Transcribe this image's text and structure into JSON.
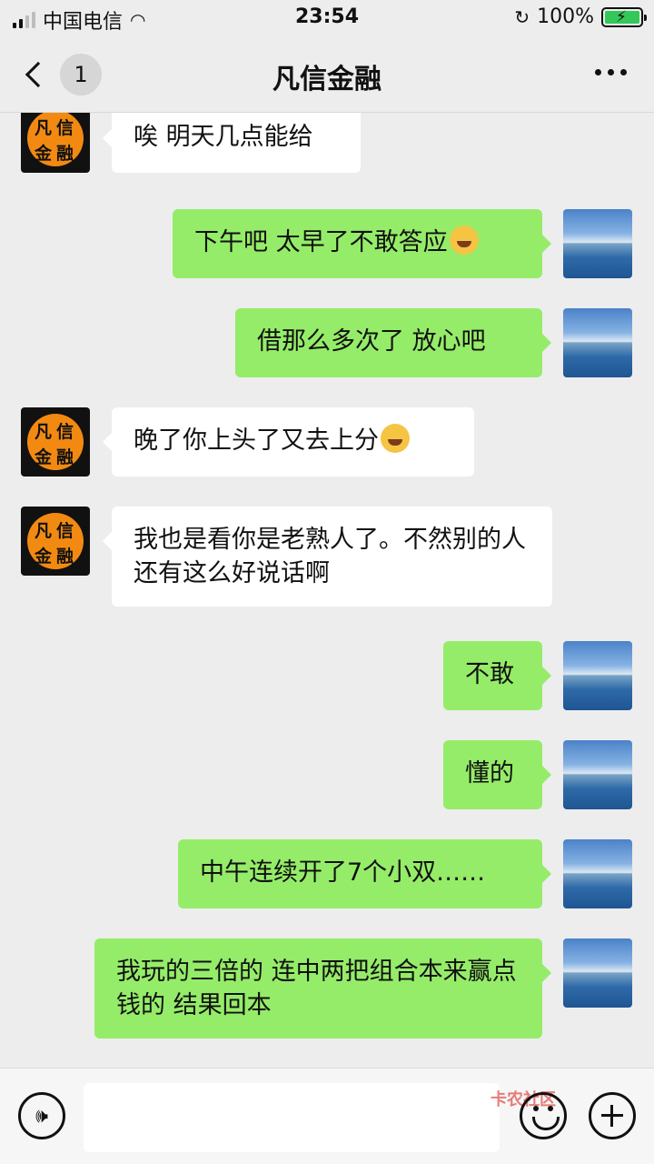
{
  "status_bar": {
    "carrier": "中国电信",
    "time": "23:54",
    "battery": "100%"
  },
  "header": {
    "title": "凡信金融",
    "unread_count": "1"
  },
  "contact_avatar": {
    "text": [
      "凡",
      "信",
      "金",
      "融"
    ]
  },
  "messages": [
    {
      "side": "in",
      "text": "唉 明天几点能给",
      "emoji": false
    },
    {
      "side": "out",
      "text": "下午吧 太早了不敢答应",
      "emoji": true
    },
    {
      "side": "out",
      "text": "借那么多次了 放心吧",
      "emoji": false
    },
    {
      "side": "in",
      "text": "晚了你上头了又去上分",
      "emoji": true
    },
    {
      "side": "in",
      "text": "我也是看你是老熟人了。不然别的人还有这么好说话啊",
      "emoji": false
    },
    {
      "side": "out",
      "text": "不敢",
      "emoji": false
    },
    {
      "side": "out",
      "text": "懂的",
      "emoji": false
    },
    {
      "side": "out",
      "text": "中午连续开了7个小双……",
      "emoji": false
    },
    {
      "side": "out",
      "text": "我玩的三倍的 连中两把组合本来赢点钱的 结果回本",
      "emoji": false
    }
  ],
  "watermark": "卡农社区",
  "colors": {
    "outgoing_bubble": "#95ec69",
    "incoming_bubble": "#ffffff",
    "background": "#ededed"
  }
}
